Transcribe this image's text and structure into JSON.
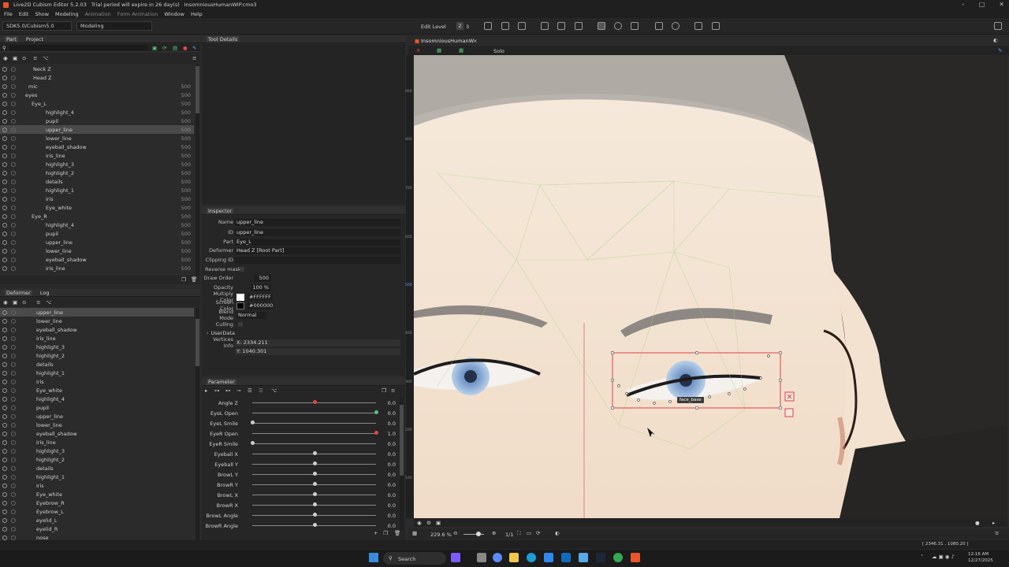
{
  "titlebar": {
    "app": "Live2D Cubism Editor 5.2.03",
    "trial": "Trial period will expire in 26 day(s)",
    "file": "InsomniousHumanWIP.cmo3"
  },
  "menu": [
    {
      "label": "File"
    },
    {
      "label": "Edit"
    },
    {
      "label": "Show"
    },
    {
      "label": "Modeling"
    },
    {
      "label": "Animation"
    },
    {
      "label": "Form Animation"
    },
    {
      "label": "Window"
    },
    {
      "label": "Help"
    }
  ],
  "toolbar": {
    "sdk": "SDK5.0/Cubism5.0",
    "mode": "Modeling",
    "edit_level": "Edit Level",
    "level_a": "2",
    "level_b": "3"
  },
  "part_panel": {
    "tabs": [
      "Part",
      "Project"
    ],
    "rows": [
      {
        "label": "Neck Z",
        "num": ""
      },
      {
        "label": "Head Z",
        "num": ""
      },
      {
        "label": "mic",
        "num": "500"
      },
      {
        "label": "eyes",
        "num": "500"
      },
      {
        "label": "Eye_L",
        "num": "500"
      },
      {
        "label": "highlight_4",
        "num": "500"
      },
      {
        "label": "pupil",
        "num": "500"
      },
      {
        "label": "upper_line",
        "num": "500"
      },
      {
        "label": "lower_line",
        "num": "500"
      },
      {
        "label": "eyeball_shadow",
        "num": "500"
      },
      {
        "label": "iris_line",
        "num": "500"
      },
      {
        "label": "highlight_3",
        "num": "500"
      },
      {
        "label": "highlight_2",
        "num": "500"
      },
      {
        "label": "details",
        "num": "500"
      },
      {
        "label": "highlight_1",
        "num": "500"
      },
      {
        "label": "iris",
        "num": "500"
      },
      {
        "label": "Eye_white",
        "num": "500"
      },
      {
        "label": "Eye_R",
        "num": "500"
      },
      {
        "label": "highlight_4",
        "num": "500"
      },
      {
        "label": "pupil",
        "num": "500"
      },
      {
        "label": "upper_line",
        "num": "500"
      },
      {
        "label": "lower_line",
        "num": "500"
      },
      {
        "label": "eyeball_shadow",
        "num": "500"
      },
      {
        "label": "iris_line",
        "num": "500"
      }
    ]
  },
  "deformer_panel": {
    "tabs": [
      "Deformer",
      "Log"
    ],
    "rows": [
      "upper_line",
      "lower_line",
      "eyeball_shadow",
      "iris_line",
      "highlight_3",
      "highlight_2",
      "details",
      "highlight_1",
      "iris",
      "Eye_white",
      "highlight_4",
      "pupil",
      "upper_line",
      "lower_line",
      "eyeball_shadow",
      "iris_line",
      "highlight_3",
      "highlight_2",
      "details",
      "highlight_1",
      "iris",
      "Eye_white",
      "Eyebrow_R",
      "Eyebrow_L",
      "eyelid_L",
      "eyelid_R",
      "nose"
    ]
  },
  "tool_details": {
    "title": "Tool Details"
  },
  "inspector": {
    "title": "Inspector",
    "name": "upper_line",
    "id": "upper_line",
    "part": "Eye_L",
    "deformer": "Head Z  [Root Part]",
    "clipping_id": "",
    "reverse_mask": "Reverse mask",
    "draw_order": "500",
    "opacity": "100 %",
    "multiply_color": "#FFFFFF",
    "screen_color": "#000000",
    "blend_mode": "Normal",
    "culling": "Culling",
    "userdata": "UserData",
    "vertices_x": "X: 2334.211",
    "vertices_y": "Y: 1040.301",
    "labels": {
      "name": "Name",
      "id": "ID",
      "part": "Part",
      "deformer": "Deformer",
      "clipping": "Clipping ID",
      "draw_order": "Draw Order",
      "opacity": "Opacity",
      "multiply": "Multiply Color",
      "screen": "Screen Color",
      "blend": "Blend Mode",
      "vertices": "Vertices Info"
    }
  },
  "parameter": {
    "title": "Parameter",
    "rows": [
      {
        "name": "Angle Z",
        "value": "0.0",
        "pos": 0.5,
        "key": true
      },
      {
        "name": "EyeL Open",
        "value": "0.0",
        "pos": 0,
        "key": true
      },
      {
        "name": "EyeL Smile",
        "value": "0.0",
        "pos": 0,
        "key": false
      },
      {
        "name": "EyeR Open",
        "value": "1.0",
        "pos": 1,
        "key": true
      },
      {
        "name": "EyeR Smile",
        "value": "0.0",
        "pos": 0,
        "key": false
      },
      {
        "name": "Eyeball X",
        "value": "0.0",
        "pos": 0.5,
        "key": false
      },
      {
        "name": "Eyeball Y",
        "value": "0.0",
        "pos": 0.5,
        "key": false
      },
      {
        "name": "BrowL Y",
        "value": "0.0",
        "pos": 0.5,
        "key": false
      },
      {
        "name": "BrowR Y",
        "value": "0.0",
        "pos": 0.5,
        "key": false
      },
      {
        "name": "BrowL X",
        "value": "0.0",
        "pos": 0.5,
        "key": false
      },
      {
        "name": "BrowR X",
        "value": "0.0",
        "pos": 0.5,
        "key": false
      },
      {
        "name": "BrowL Angle",
        "value": "0.0",
        "pos": 0.5,
        "key": false
      },
      {
        "name": "BrowR Angle",
        "value": "0.0",
        "pos": 0.5,
        "key": false
      }
    ]
  },
  "view": {
    "tab": "InsomniousHumanW",
    "solo": "Solo",
    "zoom": "229.6 %",
    "page": "1/1",
    "coords": "[ 2346.31 , 1080.20 ]",
    "tooltip": "face_base",
    "ruler": [
      "900",
      "800",
      "700",
      "600",
      "500",
      "400",
      "300",
      "200",
      "100"
    ]
  },
  "taskbar": {
    "search": "Search",
    "time": "12:16 AM",
    "date": "12/27/2025"
  },
  "colors": {
    "accent": "#e8562a",
    "selection": "#e0404a",
    "mesh": "#9fd37a"
  }
}
